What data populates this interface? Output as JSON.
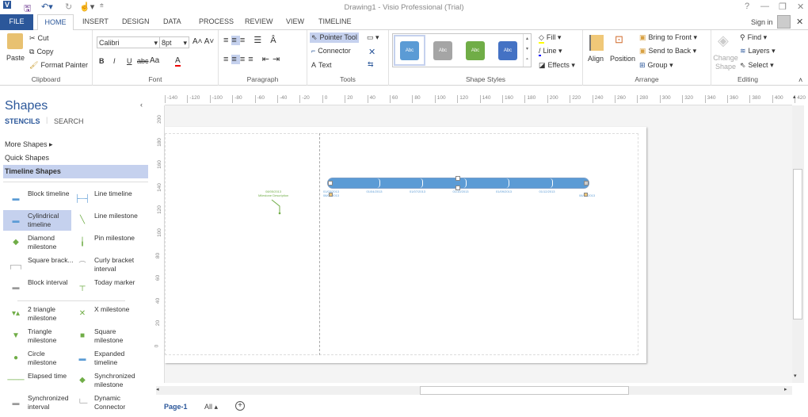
{
  "window": {
    "title": "Drawing1 - Visio Professional (Trial)",
    "sign_in": "Sign in",
    "help": "?",
    "minimize": "—",
    "restore": "❐",
    "close": "✕"
  },
  "tabs": [
    "FILE",
    "HOME",
    "INSERT",
    "DESIGN",
    "DATA",
    "PROCESS",
    "REVIEW",
    "VIEW",
    "TIMELINE"
  ],
  "ribbon": {
    "clipboard": {
      "label": "Clipboard",
      "paste": "Paste",
      "cut": "Cut",
      "copy": "Copy",
      "format_painter": "Format Painter"
    },
    "font": {
      "label": "Font",
      "font_name": "Calibri",
      "font_size": "8pt",
      "bold": "B",
      "italic": "I",
      "underline": "U",
      "strike": "abc",
      "case": "Aa",
      "color": "A"
    },
    "paragraph": {
      "label": "Paragraph"
    },
    "tools": {
      "label": "Tools",
      "pointer": "Pointer Tool",
      "connector": "Connector",
      "text": "Text"
    },
    "shape_styles": {
      "label": "Shape Styles",
      "swatch_text": "Abc",
      "swatches": [
        "#5b9bd5",
        "#a5a5a5",
        "#70ad47",
        "#4472c4"
      ],
      "fill": "Fill",
      "line": "Line",
      "effects": "Effects"
    },
    "arrange": {
      "label": "Arrange",
      "align": "Align",
      "position": "Position",
      "bring_to_front": "Bring to Front",
      "send_to_back": "Send to Back",
      "group": "Group"
    },
    "editing": {
      "label": "Editing",
      "change_shape": "Change Shape",
      "find": "Find",
      "layers": "Layers",
      "select": "Select"
    }
  },
  "panel": {
    "title": "Shapes",
    "stencils": "STENCILS",
    "search": "SEARCH",
    "more_shapes": "More Shapes",
    "quick_shapes": "Quick Shapes",
    "timeline_shapes": "Timeline Shapes",
    "shapes": [
      [
        "Block timeline",
        "Line timeline"
      ],
      [
        "Cylindrical timeline",
        "Line milestone"
      ],
      [
        "Diamond milestone",
        "Pin milestone"
      ],
      [
        "Square brack...",
        "Curly bracket interval"
      ],
      [
        "Block interval",
        "Today marker"
      ],
      [
        "2 triangle milestone",
        "X milestone"
      ],
      [
        "Triangle milestone",
        "Square milestone"
      ],
      [
        "Circle milestone",
        "Expanded timeline"
      ],
      [
        "Elapsed time",
        "Synchronized milestone"
      ],
      [
        "Synchronized interval",
        "Dynamic Connector"
      ]
    ]
  },
  "ruler_h": [
    "-140",
    "-120",
    "-100",
    "-80",
    "-60",
    "-40",
    "-20",
    "0",
    "20",
    "40",
    "60",
    "80",
    "100",
    "120",
    "140",
    "160",
    "180",
    "200",
    "220",
    "240",
    "260",
    "280",
    "300",
    "320",
    "340",
    "360",
    "380",
    "400",
    "420"
  ],
  "ruler_v": [
    "200",
    "180",
    "160",
    "140",
    "120",
    "100",
    "80",
    "60",
    "40",
    "20",
    "0"
  ],
  "diagram": {
    "milestone_date": "08/05/2013",
    "milestone_text": "Milestone Description",
    "timeline_labels": [
      "01/03/2013",
      "01/04/2013",
      "01/07/2013",
      "01/10/2013",
      "01/09/2013",
      "01/12/2013"
    ],
    "start": "08/03/2013",
    "end": "08/12/2013"
  },
  "footer": {
    "page": "Page-1",
    "all": "All ▴",
    "add": "+"
  }
}
